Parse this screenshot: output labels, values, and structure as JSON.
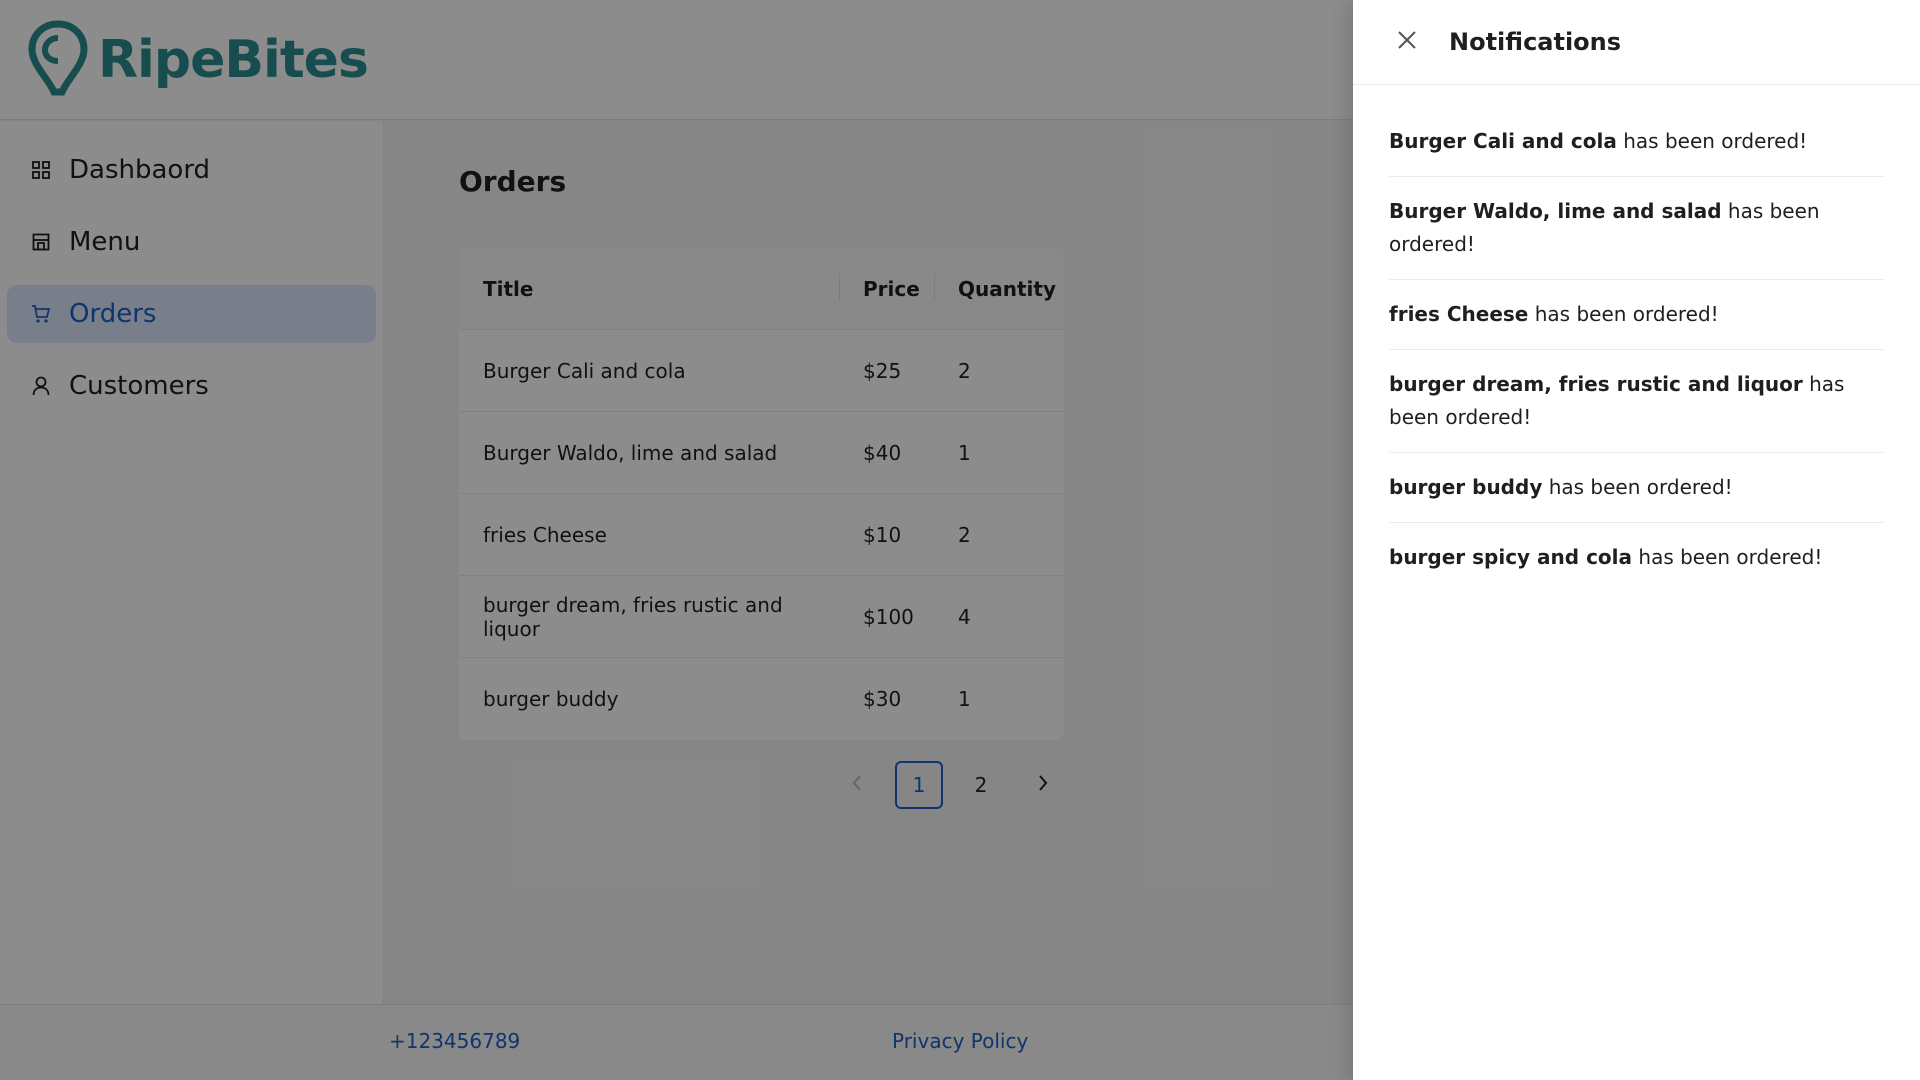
{
  "brand": {
    "name": "RipeBites",
    "color": "#2b8c8e"
  },
  "sidebar": {
    "items": [
      {
        "label": "Dashbaord",
        "icon": "dashboard-icon",
        "active": false
      },
      {
        "label": "Menu",
        "icon": "store-icon",
        "active": false
      },
      {
        "label": "Orders",
        "icon": "cart-icon",
        "active": true
      },
      {
        "label": "Customers",
        "icon": "user-icon",
        "active": false
      }
    ]
  },
  "main": {
    "title": "Orders",
    "table": {
      "headers": [
        "Title",
        "Price",
        "Quantity"
      ],
      "rows": [
        {
          "title": "Burger Cali and cola",
          "price": "$25",
          "quantity": "2"
        },
        {
          "title": "Burger Waldo, lime and salad",
          "price": "$40",
          "quantity": "1"
        },
        {
          "title": "fries Cheese",
          "price": "$10",
          "quantity": "2"
        },
        {
          "title": "burger dream, fries rustic and liquor",
          "price": "$100",
          "quantity": "4"
        },
        {
          "title": "burger buddy",
          "price": "$30",
          "quantity": "1"
        }
      ]
    },
    "pagination": {
      "pages": [
        "1",
        "2"
      ],
      "current": "1"
    }
  },
  "footer": {
    "phone": "+123456789",
    "privacy": "Privacy Policy"
  },
  "drawer": {
    "title": "Notifications",
    "suffix": "has been ordered!",
    "items": [
      {
        "item": "Burger Cali and cola",
        "suffix": " has been ordered!"
      },
      {
        "item": "Burger Waldo, lime and salad",
        "suffix": " has been ordered!"
      },
      {
        "item": "fries Cheese",
        "suffix": " has been ordered!"
      },
      {
        "item": "burger dream, fries rustic and liquor",
        "suffix": " has been ordered!"
      },
      {
        "item": "burger buddy",
        "suffix": " has been ordered!"
      },
      {
        "item": "burger spicy and cola",
        "suffix": " has been ordered!"
      }
    ]
  },
  "colors": {
    "accent": "#1d5fc8",
    "active_bg": "#dbe8fb",
    "overlay": "rgba(0,0,0,0.45)"
  }
}
